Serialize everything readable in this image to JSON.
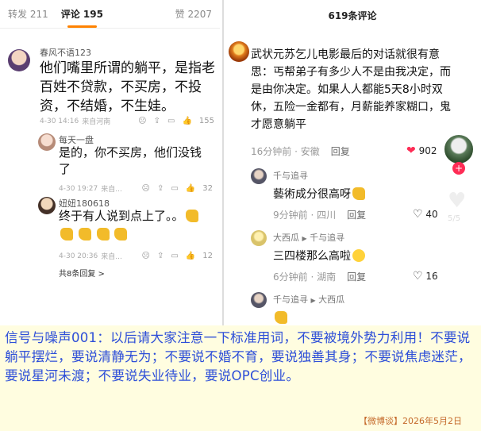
{
  "left": {
    "tabs": {
      "repost": "转发 211",
      "comments": "评论 195",
      "likes": "赞 2207"
    },
    "main_comment": {
      "author": "春风不语123",
      "text": [
        "他们嘴里所谓的躺平，是指老",
        "百姓不贷款，不买房，不投",
        "资，不结婚，不生娃。"
      ],
      "time": "4-30 14:16",
      "location": "来自河南",
      "like_count": "155"
    },
    "replies": [
      {
        "author": "每天一盘",
        "text": [
          "是的，你不买房，他们没钱",
          "了"
        ],
        "time": "4-30 19:27",
        "location": "来自...",
        "like_count": "32"
      },
      {
        "author": "妞妞180618",
        "text": [
          "终于有人说到点上了。。"
        ],
        "time": "4-30 20:36",
        "location": "来自...",
        "like_count": "12"
      }
    ],
    "more_replies": "共8条回复 >"
  },
  "right": {
    "header": "619条评论",
    "main_comment": {
      "text": [
        "武状元苏乞儿电影最后的对话就很有意",
        "思：丐帮弟子有多少人不是由我决定，而",
        "是由你决定。如果人人都能5天8小时双",
        "休，五险一金都有，月薪能养家糊口，鬼",
        "才愿意躺平"
      ],
      "time": "16分钟前",
      "location": "安徽",
      "reply": "回复",
      "likes": "902"
    },
    "sub_comments": [
      {
        "author": "千与追寻",
        "text": "藝術成分很高呀",
        "time": "9分钟前",
        "location": "四川",
        "reply": "回复",
        "likes": "40"
      },
      {
        "author": "大西瓜",
        "reply_to": "千与追寻",
        "text": "三四楼那么高啦",
        "time": "6分钟前",
        "location": "湖南",
        "reply": "回复",
        "likes": "16"
      },
      {
        "author": "千与追寻",
        "reply_to": "大西瓜"
      }
    ],
    "rail_count": "5/5"
  },
  "banner": {
    "text": "信号与噪声001：以后请大家注意一下标准用词，不要被境外势力利用！不要说躺平摆烂，要说清静无为；不要说不婚不育，要说独善其身；不要说焦虑迷茫，要说星河未渡；不要说失业待业，要说OPC创业。",
    "source": "【微博谈】2026年5月2日"
  },
  "colors": {
    "accent_orange": "#ff8200",
    "heart_red": "#fe2c55",
    "banner_bg": "#fffde0",
    "banner_text": "#2d4ed8",
    "source_text": "#c56a2b"
  }
}
